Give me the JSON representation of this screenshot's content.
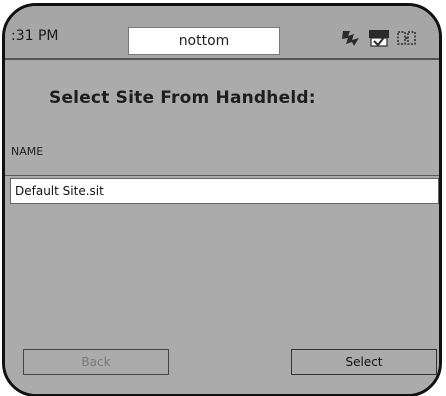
{
  "status_bar": {
    "time": ":31 PM",
    "title": "nottom",
    "icons": [
      "connectivity-icon",
      "message-icon",
      "signal-icon"
    ]
  },
  "main": {
    "heading": "Select Site From Handheld:",
    "column_header": "NAME",
    "rows": [
      {
        "name": "Default Site.sit"
      }
    ]
  },
  "buttons": {
    "back_label": "Back",
    "select_label": "Select"
  },
  "colors": {
    "background": "#ababab",
    "selected_row": "#ffffff"
  }
}
